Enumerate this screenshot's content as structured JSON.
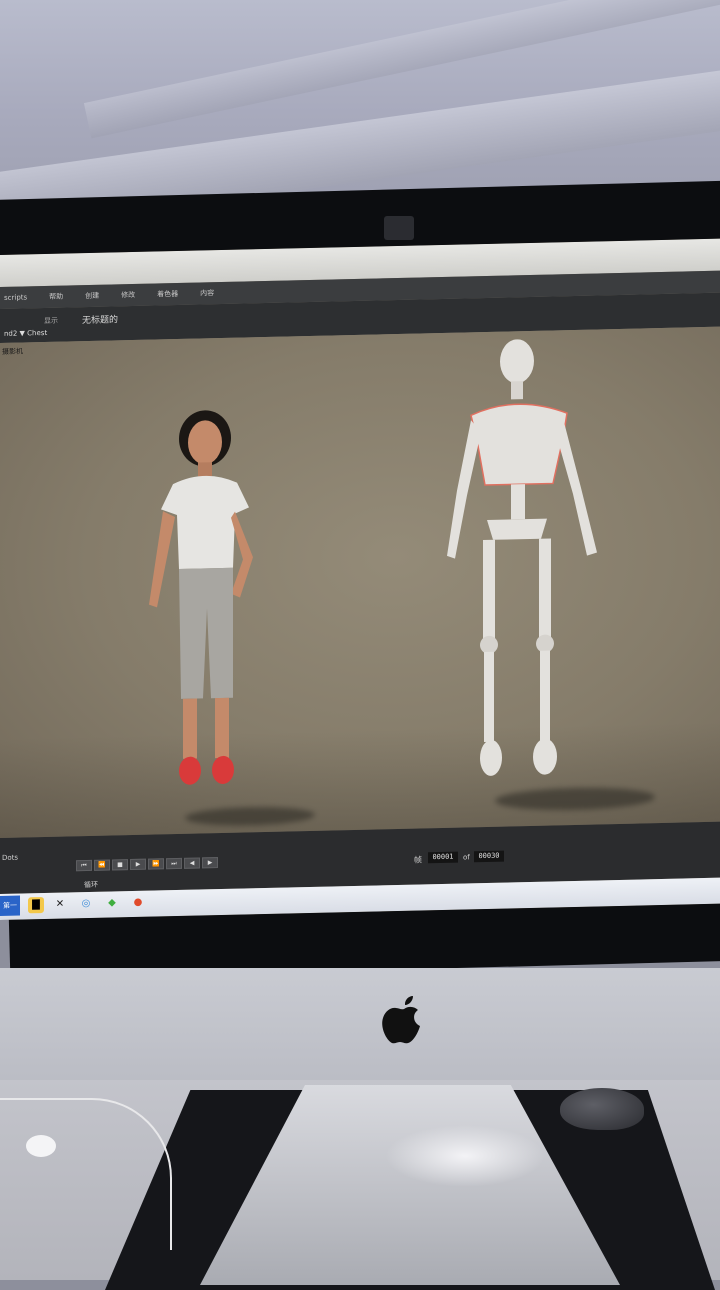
{
  "app": {
    "menu_items": [
      "scripts",
      "帮助",
      "创建",
      "修改",
      "着色器",
      "内容"
    ],
    "toolbar_label": "显示",
    "document_title": "无标题的",
    "selector": "nd2 ▼ Chest",
    "camera_label": "摄影机"
  },
  "timeline": {
    "dots_label": "Dots",
    "loop_label": "循环",
    "frame_label": "帧",
    "current_frame": "00001",
    "of_label": "of",
    "total_frames": "00030",
    "transport_glyphs": [
      "⏮",
      "⏪",
      "■",
      "▶",
      "⏩",
      "⏭",
      "◀",
      "▶"
    ]
  },
  "taskbar": {
    "start_label": "第一页",
    "icons": [
      "folder-icon",
      "figure-icon",
      "browser-icon",
      "app-icon",
      "record-icon"
    ]
  },
  "colors": {
    "viewport": "#8b8374",
    "shoes": "#d93a3a",
    "figure_skin": "#c48a6a",
    "mannequin": "#e3e1dd"
  }
}
